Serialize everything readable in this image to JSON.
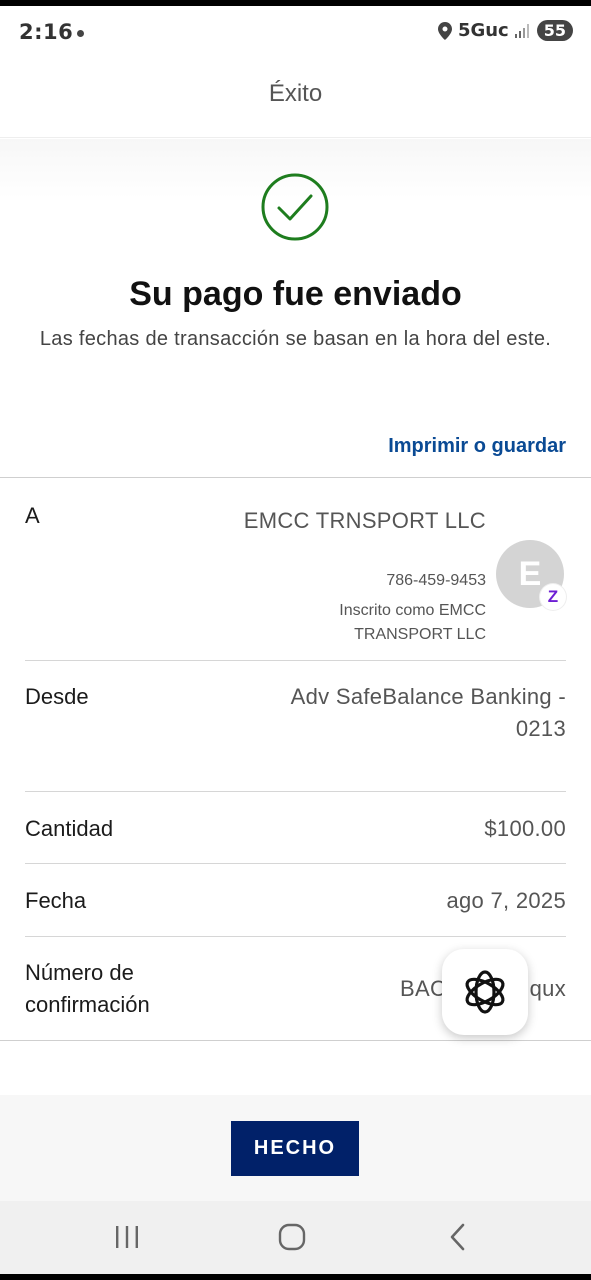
{
  "status_bar": {
    "time": "2:16",
    "network": "5Guc",
    "battery": "55"
  },
  "header": {
    "title": "Éxito"
  },
  "success": {
    "icon": "check-circle-icon",
    "title": "Su pago fue enviado",
    "subtitle": "Las fechas de transacción se basan en la hora del este.",
    "print_link": "Imprimir o guardar",
    "check_color": "#1e7d1e"
  },
  "details": {
    "to": {
      "label": "A",
      "name": "EMCC TRNSPORT LLC",
      "phone": "786-459-9453",
      "enrolled": "Inscrito como EMCC TRANSPORT LLC",
      "avatar_letter": "E",
      "badge": "Z"
    },
    "from": {
      "label": "Desde",
      "value": "Adv SafeBalance Banking - 0213"
    },
    "amount": {
      "label": "Cantidad",
      "value": "$100.00"
    },
    "date": {
      "label": "Fecha",
      "value": "ago 7, 2025"
    },
    "confirmation": {
      "label": "Número de confirmación",
      "value_start": "BAC",
      "value_end": "qux"
    }
  },
  "footer": {
    "done_label": "HECHO",
    "button_color": "#012169"
  },
  "nav": {
    "recents_icon": "recents-icon",
    "home_icon": "home-icon",
    "back_icon": "back-icon"
  }
}
